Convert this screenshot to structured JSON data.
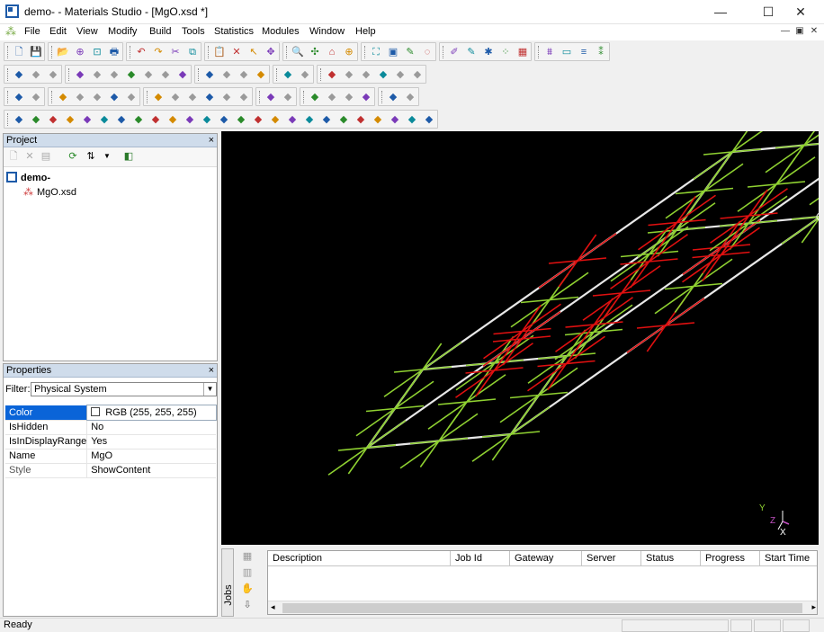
{
  "window": {
    "title": "demo- - Materials Studio - [MgO.xsd *]",
    "minimize_label": "—",
    "maximize_label": "☐",
    "close_label": "✕"
  },
  "menu": {
    "items": [
      "File",
      "Edit",
      "View",
      "Modify",
      "Build",
      "Tools",
      "Statistics",
      "Modules",
      "Window",
      "Help"
    ],
    "mdi": [
      "—",
      "▣",
      "✕"
    ]
  },
  "toolbars": {
    "row1": [
      "new-icon",
      "save-icon",
      "open-folder-icon",
      "import-icon",
      "export-icon",
      "print-icon",
      "undo-icon",
      "redo-icon",
      "cut-icon",
      "copy-icon",
      "paste-icon",
      "delete-icon",
      "select-icon",
      "rotate-icon",
      "zoom-icon",
      "translate-icon",
      "build-icon",
      "center-icon",
      "fit-icon",
      "screenshot-icon",
      "sketch-pencil-icon",
      "sketch-ring-icon",
      "draw-icon",
      "color-icon",
      "crystal-icon",
      "symmetry-icon",
      "lattice-icon",
      "filter-icon",
      "chart-icon",
      "list-icon",
      "arrange-icon"
    ],
    "row2": [
      "prev-frame-icon",
      "next-frame-icon",
      "link-icon",
      "table-icon",
      "bar-chart-icon",
      "sort-asc-icon",
      "sort-desc-icon",
      "funnel-icon",
      "lock-icon",
      "edit-cell-icon",
      "atom-a-icon",
      "abc-icon",
      "atom-b-icon",
      "grid-icon",
      "sort-az-icon",
      "sort-za-icon",
      "play-first-icon",
      "play-prev-icon",
      "stop-icon",
      "play-next-icon",
      "pause-icon",
      "loop-icon"
    ],
    "row3": [
      "grid-view-icon",
      "function-icon",
      "pointer-icon",
      "lasso-icon",
      "move-icon",
      "spectrum-icon",
      "export-plot-icon",
      "table-a-icon",
      "table-b-icon",
      "table-c-icon",
      "table-d-icon",
      "table-e-icon",
      "camera-icon",
      "layer-icon",
      "atom-blue-icon",
      "bond-red-icon",
      "bond-blue-icon",
      "bond-x-icon",
      "page-icon",
      "play-icon",
      "record-icon"
    ],
    "row4": [
      "module-forcite-icon",
      "module-dmol-icon",
      "module-castep-icon",
      "module-mesocite-icon",
      "module-amorphous-icon",
      "module-sorption-icon",
      "module-blends-icon",
      "module-conformers-icon",
      "module-qsar-icon",
      "module-gulp-icon",
      "module-morphology-icon",
      "module-kinetix-icon",
      "module-reflex-icon",
      "module-polymorph-icon",
      "module-synthia-icon",
      "module-vamp-icon",
      "module-dftb-icon",
      "module-onetep-icon",
      "module-motif-icon",
      "module-mesodyn-icon",
      "module-dpd-icon",
      "module-adsorption-icon",
      "module-equilibria-icon",
      "module-cleave-icon",
      "module-analysis-icon"
    ]
  },
  "project": {
    "title": "Project",
    "close_label": "×",
    "tree": [
      {
        "label": "demo-",
        "bold": true
      },
      {
        "label": "MgO.xsd",
        "bold": false
      }
    ]
  },
  "properties": {
    "title": "Properties",
    "close_label": "×",
    "filter_label": "Filter:",
    "filter_value": "Physical System",
    "rows": [
      {
        "key": "Color",
        "value": "RGB (255, 255, 255)",
        "selected": true,
        "enabled": true
      },
      {
        "key": "IsHidden",
        "value": "No",
        "selected": false,
        "enabled": true
      },
      {
        "key": "IsInDisplayRange",
        "value": "Yes",
        "selected": false,
        "enabled": true
      },
      {
        "key": "Name",
        "value": "MgO",
        "selected": false,
        "enabled": true
      },
      {
        "key": "Style",
        "value": "ShowContent",
        "selected": false,
        "enabled": false
      }
    ]
  },
  "viewer": {
    "background": "#000000",
    "cell_color": "#e8e8e8",
    "atom_green": "#8fd131",
    "atom_red": "#e01010",
    "axis_labels": [
      "Y",
      "Z",
      "X"
    ]
  },
  "jobs": {
    "tab_label": "Jobs",
    "columns": [
      "Description",
      "Job Id",
      "Gateway",
      "Server",
      "Status",
      "Progress",
      "Start Time"
    ]
  },
  "status": {
    "text": "Ready"
  }
}
